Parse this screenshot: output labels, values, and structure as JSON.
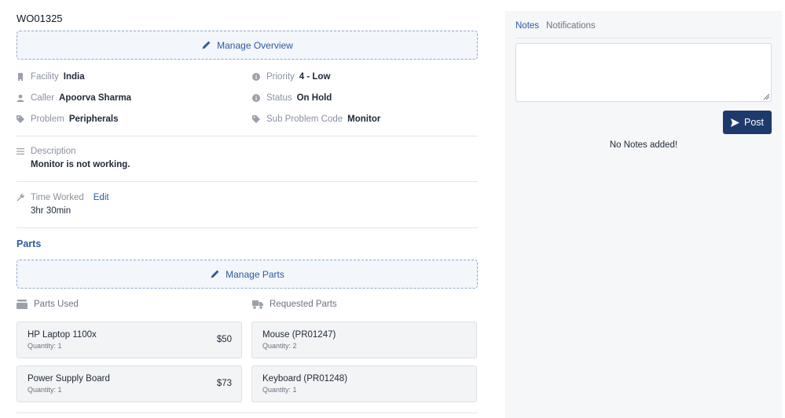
{
  "work_order": {
    "id": "WO01325"
  },
  "overview": {
    "manage_label": "Manage Overview",
    "facility": {
      "label": "Facility",
      "value": "India",
      "icon": "building-icon"
    },
    "priority": {
      "label": "Priority",
      "value": "4 - Low",
      "icon": "info-icon"
    },
    "caller": {
      "label": "Caller",
      "value": "Apoorva Sharma",
      "icon": "user-icon"
    },
    "status": {
      "label": "Status",
      "value": "On Hold",
      "icon": "info-icon"
    },
    "problem": {
      "label": "Problem",
      "value": "Peripherals",
      "icon": "tag-icon"
    },
    "sub_problem": {
      "label": "Sub Problem Code",
      "value": "Monitor",
      "icon": "tag-icon"
    }
  },
  "description": {
    "label": "Description",
    "value": "Monitor is not working.",
    "icon": "lines-icon"
  },
  "time_worked": {
    "label": "Time Worked",
    "edit_label": "Edit",
    "value": "3hr 30min",
    "icon": "wrench-icon"
  },
  "parts": {
    "title": "Parts",
    "manage_label": "Manage Parts",
    "used_heading": "Parts Used",
    "requested_heading": "Requested Parts",
    "used": [
      {
        "name": "HP Laptop 1100x",
        "quantity": "Quantity: 1",
        "price": "$50"
      },
      {
        "name": "Power Supply Board",
        "quantity": "Quantity: 1",
        "price": "$73"
      }
    ],
    "requested": [
      {
        "name": "Mouse (PR01247)",
        "quantity": "Quantity: 2"
      },
      {
        "name": "Keyboard (PR01248)",
        "quantity": "Quantity: 1"
      }
    ]
  },
  "side_panel": {
    "tabs": [
      {
        "label": "Notes",
        "active": true
      },
      {
        "label": "Notifications",
        "active": false
      }
    ],
    "note_value": "",
    "post_label": "Post",
    "empty_message": "No Notes added!"
  },
  "colors": {
    "accent": "#2d5aa0",
    "post_button": "#1e3a6b",
    "panel_bg": "#f6f7f9"
  }
}
